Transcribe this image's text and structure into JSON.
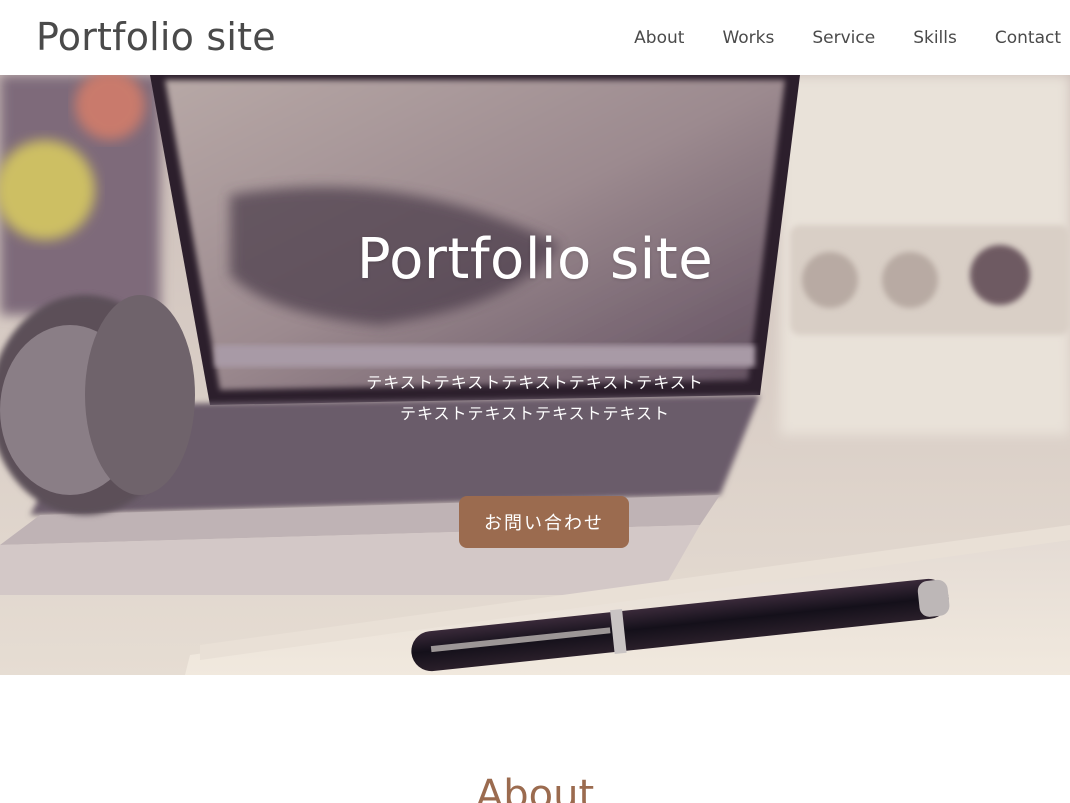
{
  "header": {
    "site_title": "Portfolio site",
    "nav": [
      {
        "label": "About"
      },
      {
        "label": "Works"
      },
      {
        "label": "Service"
      },
      {
        "label": "Skills"
      },
      {
        "label": "Contact"
      }
    ]
  },
  "hero": {
    "title": "Portfolio site",
    "text": "テキストテキストテキストテキストテキストテキストテキストテキストテキスト",
    "button_label": "お問い合わせ"
  },
  "about": {
    "heading": "About"
  },
  "colors": {
    "accent": "#9b6b4f",
    "header_text": "#4a4a4a",
    "hero_text": "#ffffff"
  }
}
